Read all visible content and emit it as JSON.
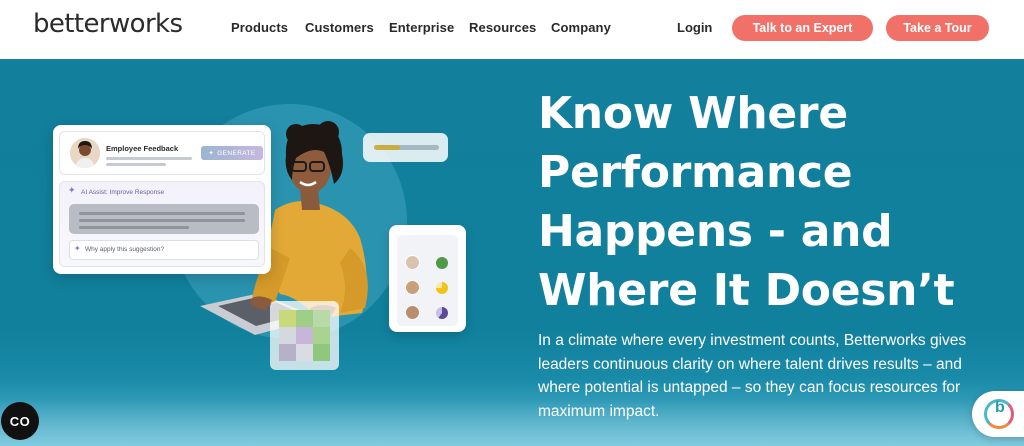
{
  "header": {
    "logo_text": "betterworks",
    "nav": [
      {
        "label": "Products"
      },
      {
        "label": "Customers"
      },
      {
        "label": "Enterprise"
      },
      {
        "label": "Resources"
      },
      {
        "label": "Company"
      }
    ],
    "login_label": "Login",
    "cta_expert_label": "Talk to an Expert",
    "cta_tour_label": "Take a Tour"
  },
  "hero": {
    "headline_lines": [
      "Know Where",
      "Performance",
      "Happens - and",
      "Where It Doesn’t"
    ],
    "subtext_lines": [
      "In a climate where every investment counts, Betterworks gives",
      "leaders continuous clarity on where talent drives results – and",
      "where potential is untapped – so they can focus resources for",
      "maximum impact."
    ]
  },
  "feedback_card": {
    "title": "Employee Feedback",
    "generate_label": "GENERATE",
    "ai_assist_label": "AI Assist: Improve Response",
    "why_label": "Why apply this suggestion?"
  },
  "progress_card": {
    "fill_fraction": 0.4
  },
  "badge": {
    "label": "CO"
  },
  "colors": {
    "accent": "#f17068",
    "hero_bg": "#10809c",
    "text_dark": "#2a2a2a"
  }
}
